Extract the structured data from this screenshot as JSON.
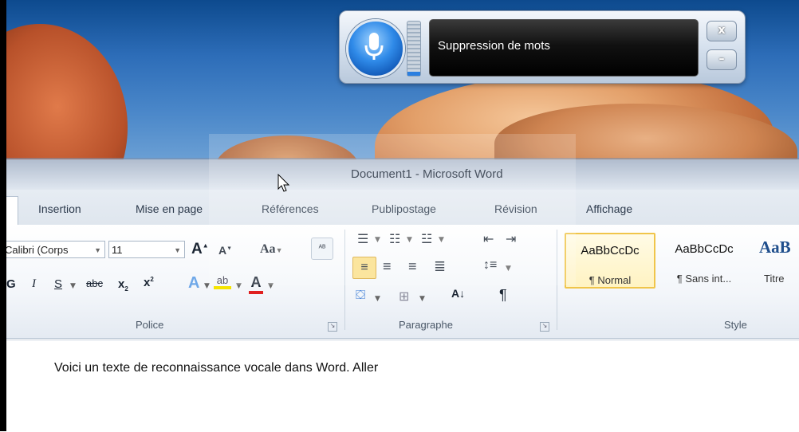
{
  "speech": {
    "status_text": "Suppression de mots",
    "level": 0.08,
    "close_label": "x",
    "minimize_label": "–"
  },
  "word": {
    "title": "Document1  -  Microsoft Word",
    "tabs": [
      {
        "label": "Insertion"
      },
      {
        "label": "Mise en page"
      },
      {
        "label": "Références"
      },
      {
        "label": "Publipostage"
      },
      {
        "label": "Révision"
      },
      {
        "label": "Affichage"
      }
    ],
    "font": {
      "name": "Calibri (Corps",
      "size": "11",
      "group_label": "Police"
    },
    "paragraph": {
      "group_label": "Paragraphe"
    },
    "styles": {
      "group_label": "Style",
      "tiles": [
        {
          "sample": "AaBbCcDc",
          "name": "¶ Normal"
        },
        {
          "sample": "AaBbCcDc",
          "name": "¶ Sans int..."
        },
        {
          "sample": "AaB",
          "name": "Titre"
        }
      ]
    },
    "document_text": "Voici un texte de reconnaissance vocale dans Word. Aller"
  },
  "colors": {
    "accent_blue": "#2b7fe0",
    "highlight": "#f0c54a",
    "font_color_red": "#e02020",
    "highlight_yellow": "#f5e400"
  }
}
